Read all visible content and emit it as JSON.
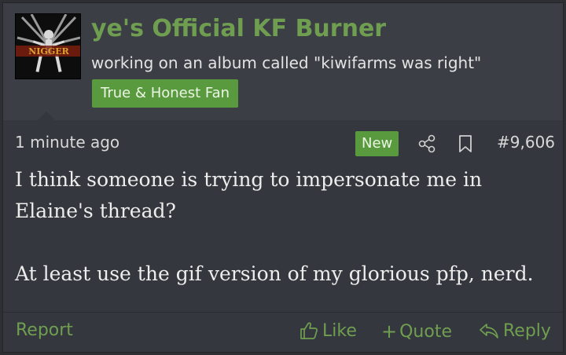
{
  "user": {
    "username": "ye's Official KF Burner",
    "custom_title": "working on an album called \"kiwifarms was right\"",
    "banner": "True & Honest Fan",
    "avatar_text": "NIGGER"
  },
  "post": {
    "timestamp": "1 minute ago",
    "new_badge": "New",
    "number": "#9,606",
    "paragraphs": [
      "I think someone is trying to impersonate me in Elaine's thread?",
      "At least use the gif version of my glorious pfp, nerd."
    ]
  },
  "footer": {
    "report": "Report",
    "like": "Like",
    "quote": "Quote",
    "reply": "Reply"
  },
  "colors": {
    "accent": "#6f9e51",
    "badge": "#5a9a3f",
    "background": "#34373d",
    "header": "#3b3e44"
  },
  "icons": {
    "share": "share-icon",
    "bookmark": "bookmark-icon",
    "like": "thumbs-up-icon",
    "quote": "plus-icon",
    "reply": "reply-arrow-icon"
  }
}
